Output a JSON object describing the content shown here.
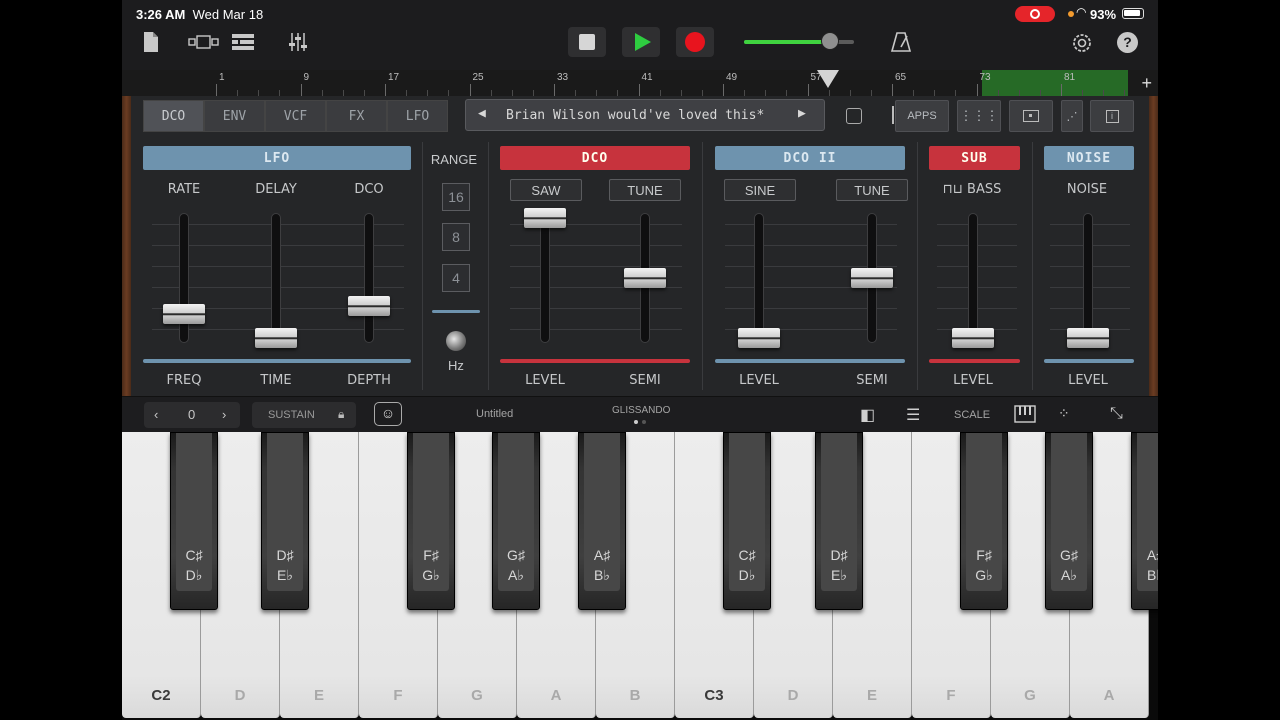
{
  "status": {
    "time": "3:26 AM",
    "date": "Wed Mar 18",
    "battery": "93%"
  },
  "toolbar": {
    "volume_fraction": 0.78
  },
  "ruler": {
    "bars": [
      "1",
      "9",
      "17",
      "25",
      "33",
      "41",
      "49",
      "57",
      "65",
      "73",
      "81"
    ]
  },
  "tabs": [
    "DCO",
    "ENV",
    "VCF",
    "FX",
    "LFO"
  ],
  "patch_name": "Brian Wilson would've loved this*",
  "right_buttons": {
    "apps": "APPS"
  },
  "synth": {
    "range_label": "RANGE",
    "range_values": [
      "16",
      "8",
      "4"
    ],
    "hz_label": "Hz",
    "sections": {
      "lfo": "LFO",
      "dco": "DCO",
      "dco2": "DCO II",
      "sub": "SUB",
      "noise": "NOISE"
    },
    "top_labels": {
      "rate": "RATE",
      "delay": "DELAY",
      "dco": "DCO",
      "saw": "SAW",
      "tune1": "TUNE",
      "sine": "SINE",
      "tune2": "TUNE",
      "bass": "BASS",
      "noise": "NOISE"
    },
    "bottom_labels": {
      "freq": "FREQ",
      "time": "TIME",
      "depth": "DEPTH",
      "level1": "LEVEL",
      "semi1": "SEMI",
      "level2": "LEVEL",
      "semi2": "SEMI",
      "level3": "LEVEL",
      "level4": "LEVEL"
    },
    "slider_values": {
      "rate": 0.2,
      "delay": 0.0,
      "dco_depth": 0.27,
      "saw_level": 1.0,
      "tune1": 0.5,
      "sine_level": 0.0,
      "tune2": 0.5,
      "bass_level": 0.0,
      "noise_level": 0.0
    }
  },
  "keyboard_bar": {
    "octave": "0",
    "sustain": "SUSTAIN",
    "title": "Untitled",
    "glissando": "GLISSANDO",
    "scale": "SCALE"
  },
  "keyboard": {
    "white_keys": [
      "C2",
      "D",
      "E",
      "F",
      "G",
      "A",
      "B",
      "C3",
      "D",
      "E",
      "F",
      "G",
      "A"
    ],
    "black_keys": [
      {
        "top": "C♯",
        "bottom": "D♭"
      },
      {
        "top": "D♯",
        "bottom": "E♭"
      },
      {
        "top": "F♯",
        "bottom": "G♭"
      },
      {
        "top": "G♯",
        "bottom": "A♭"
      },
      {
        "top": "A♯",
        "bottom": "B♭"
      },
      {
        "top": "C♯",
        "bottom": "D♭"
      },
      {
        "top": "D♯",
        "bottom": "E♭"
      },
      {
        "top": "F♯",
        "bottom": "G♭"
      },
      {
        "top": "G♯",
        "bottom": "A♭"
      },
      {
        "top": "A♯",
        "bottom": "B♭"
      }
    ]
  },
  "colors": {
    "accent_green": "#2ecc40",
    "record_red": "#e8141e",
    "section_blue": "#6e93ae",
    "section_red": "#c7333d"
  }
}
